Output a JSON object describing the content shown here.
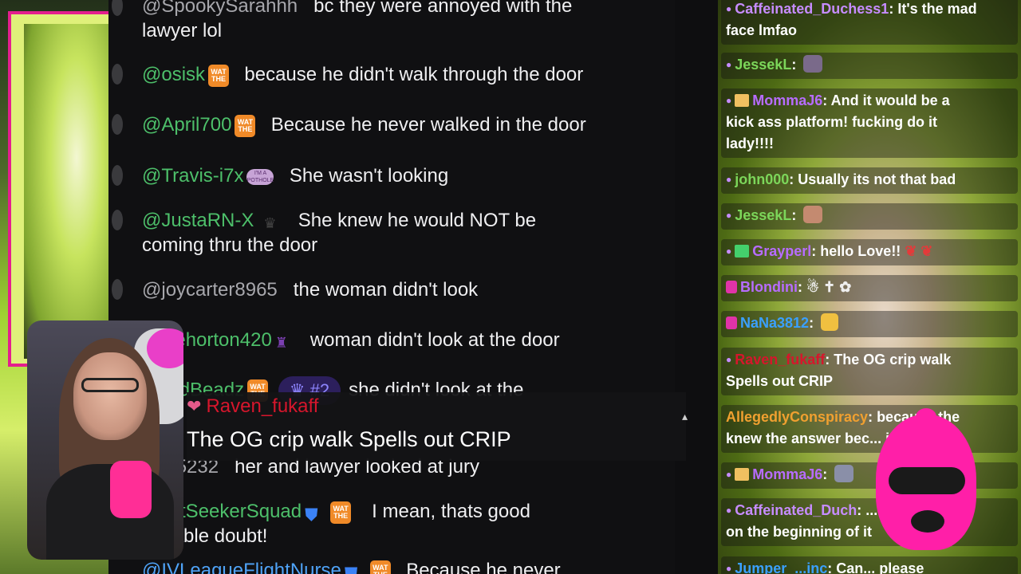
{
  "colors": {
    "pink_frame": "#e41e8e",
    "chat_bg": "#101012",
    "username_green": "#4dbf6a",
    "highlight_red": "#d6162c",
    "rank_purple": "#8e86ff"
  },
  "main_chat": {
    "messages": [
      {
        "user": "@SpookySarahhh",
        "text": "bc they were annoyed with the",
        "text2": "lawyer lol"
      },
      {
        "user": "@osisk",
        "badge": "WAT THE",
        "text": "because he didn't walk through the door"
      },
      {
        "user": "@April700",
        "badge": "WAT THE",
        "text": "Because he never walked in the door"
      },
      {
        "user": "@Travis-i7x",
        "badge": "I'M A POTHOLE",
        "text": "She wasn't looking"
      },
      {
        "user": "@JustaRN-X",
        "badge": "crown",
        "text": "She knew he would NOT be",
        "text2": "coming thru the door"
      },
      {
        "user": "@joycarter8965",
        "text": "the woman didn't look"
      },
      {
        "user": "Katiehorton420",
        "text": "woman didn't look at the door"
      },
      {
        "user": "omadBeadz",
        "badge": "WAT THE",
        "rank": "#2",
        "text": "she didn't look at the"
      },
      {
        "user": "nilla5232",
        "text": "her and lawyer looked at jury"
      },
      {
        "user": "SpiritSeekerSquad",
        "badge": "WAT THE",
        "text": "I mean, thats good",
        "text2": "sonable doubt!"
      },
      {
        "user": "@IVLeagueFlightNurse",
        "badge": "WAT THE",
        "text": "Because he never"
      }
    ]
  },
  "highlight": {
    "user": "Raven_fukaff",
    "text": "The OG crip walk Spells out CRIP"
  },
  "right_chat": {
    "messages": [
      {
        "user": "Caffeinated_Duchess1",
        "text": "It's the mad",
        "text2": "face lmfao",
        "color": "#c68cff"
      },
      {
        "user": "JessekL",
        "text": "",
        "color": "#7cd65a"
      },
      {
        "user": "MommaJ6",
        "text": "And it would be a",
        "text2": "kick ass platform! fucking do it",
        "text3": "lady!!!!",
        "color": "#b76cff"
      },
      {
        "user": "john000",
        "text": "Usually its not that bad",
        "color": "#7cd65a"
      },
      {
        "user": "JessekL",
        "text": "",
        "color": "#7cd65a"
      },
      {
        "user": "Grayperl",
        "text": "hello Love!!",
        "color": "#b76cff"
      },
      {
        "user": "Blondini",
        "text": "",
        "color": "#b76cff"
      },
      {
        "user": "NaNa3812",
        "text": "",
        "color": "#3aa0ff"
      },
      {
        "user": "Raven_fukaff",
        "text": "The OG crip walk",
        "text2": "Spells out CRIP",
        "color": "#d6162c"
      },
      {
        "user": "AllegedlyConspiracy",
        "text": "because the",
        "text2": "knew the answer bec... it",
        "color": "#f0a030"
      },
      {
        "user": "MommaJ6",
        "text": "",
        "color": "#b76cff"
      },
      {
        "user": "Caffeinated_Duch",
        "text": "...sha",
        "text2": "on the beginning of it",
        "color": "#c68cff"
      },
      {
        "user": "Jumper_...inc",
        "text": "Can... please",
        "color": "#3aa0ff"
      }
    ]
  }
}
